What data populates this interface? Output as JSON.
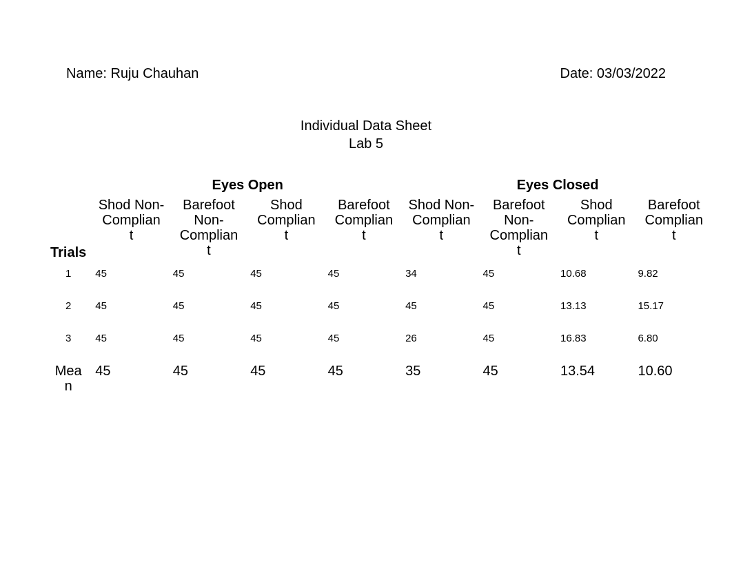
{
  "header": {
    "name_label": "Name: Ruju Chauhan",
    "date_label": "Date: 03/03/2022"
  },
  "title": {
    "line1": "Individual Data Sheet",
    "line2": "Lab 5"
  },
  "table": {
    "section_open": "Eyes Open",
    "section_closed": "Eyes Closed",
    "trials_label": "Trials",
    "mean_label": "Mea\nn",
    "columns": [
      "Shod Non-Complian\nt",
      "Barefoot Non-Complian\nt",
      "Shod Complian\nt",
      "Barefoot Complian\nt",
      "Shod Non-Complian\nt",
      "Barefoot Non-Complian\nt",
      "Shod Complian\nt",
      "Barefoot Complian\nt"
    ],
    "rows": [
      {
        "trial": "1",
        "values": [
          "45",
          "45",
          "45",
          "45",
          "34",
          "45",
          "10.68",
          "9.82"
        ]
      },
      {
        "trial": "2",
        "values": [
          "45",
          "45",
          "45",
          "45",
          "45",
          "45",
          "13.13",
          "15.17"
        ]
      },
      {
        "trial": "3",
        "values": [
          "45",
          "45",
          "45",
          "45",
          "26",
          "45",
          "16.83",
          "6.80"
        ]
      }
    ],
    "mean": [
      "45",
      "45",
      "45",
      "45",
      "35",
      "45",
      "13.54",
      "10.60"
    ]
  },
  "chart_data": {
    "type": "table",
    "title": "Individual Data Sheet – Lab 5",
    "row_labels": [
      "1",
      "2",
      "3",
      "Mean"
    ],
    "column_groups": [
      "Eyes Open",
      "Eyes Open",
      "Eyes Open",
      "Eyes Open",
      "Eyes Closed",
      "Eyes Closed",
      "Eyes Closed",
      "Eyes Closed"
    ],
    "columns": [
      "Shod Non-Compliant",
      "Barefoot Non-Compliant",
      "Shod Compliant",
      "Barefoot Compliant",
      "Shod Non-Compliant",
      "Barefoot Non-Compliant",
      "Shod Compliant",
      "Barefoot Compliant"
    ],
    "data": [
      [
        45,
        45,
        45,
        45,
        34,
        45,
        10.68,
        9.82
      ],
      [
        45,
        45,
        45,
        45,
        45,
        45,
        13.13,
        15.17
      ],
      [
        45,
        45,
        45,
        45,
        26,
        45,
        16.83,
        6.8
      ],
      [
        45,
        45,
        45,
        45,
        35,
        45,
        13.54,
        10.6
      ]
    ]
  }
}
